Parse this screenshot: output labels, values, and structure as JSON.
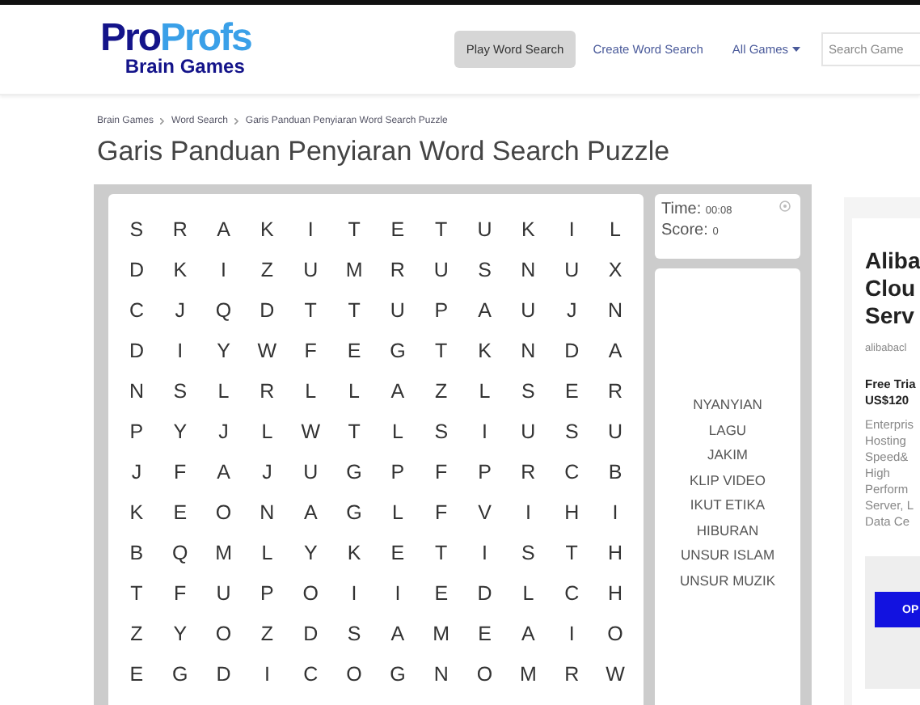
{
  "header": {
    "logo": {
      "top": "Pro",
      "top_accent": "Profs",
      "bottom": "Brain Games"
    },
    "nav": [
      {
        "label": "Play Word Search",
        "selected": true
      },
      {
        "label": "Create Word Search",
        "selected": false
      },
      {
        "label": "All Games",
        "selected": false,
        "dropdown": true
      }
    ],
    "search": {
      "placeholder": "Search Game"
    }
  },
  "breadcrumb": [
    "Brain Games",
    "Word Search",
    "Garis Panduan Penyiaran Word Search Puzzle"
  ],
  "title": "Garis Panduan Penyiaran Word Search Puzzle",
  "grid": [
    [
      "S",
      "R",
      "A",
      "K",
      "I",
      "T",
      "E",
      "T",
      "U",
      "K",
      "I",
      "L"
    ],
    [
      "D",
      "K",
      "I",
      "Z",
      "U",
      "M",
      "R",
      "U",
      "S",
      "N",
      "U",
      "X"
    ],
    [
      "C",
      "J",
      "Q",
      "D",
      "T",
      "T",
      "U",
      "P",
      "A",
      "U",
      "J",
      "N"
    ],
    [
      "D",
      "I",
      "Y",
      "W",
      "F",
      "E",
      "G",
      "T",
      "K",
      "N",
      "D",
      "A"
    ],
    [
      "N",
      "S",
      "L",
      "R",
      "L",
      "L",
      "A",
      "Z",
      "L",
      "S",
      "E",
      "R"
    ],
    [
      "P",
      "Y",
      "J",
      "L",
      "W",
      "T",
      "L",
      "S",
      "I",
      "U",
      "S",
      "U"
    ],
    [
      "J",
      "F",
      "A",
      "J",
      "U",
      "G",
      "P",
      "F",
      "P",
      "R",
      "C",
      "B"
    ],
    [
      "K",
      "E",
      "O",
      "N",
      "A",
      "G",
      "L",
      "F",
      "V",
      "I",
      "H",
      "I"
    ],
    [
      "B",
      "Q",
      "M",
      "L",
      "Y",
      "K",
      "E",
      "T",
      "I",
      "S",
      "T",
      "H"
    ],
    [
      "T",
      "F",
      "U",
      "P",
      "O",
      "I",
      "I",
      "E",
      "D",
      "L",
      "C",
      "H"
    ],
    [
      "Z",
      "Y",
      "O",
      "Z",
      "D",
      "S",
      "A",
      "M",
      "E",
      "A",
      "I",
      "O"
    ],
    [
      "E",
      "G",
      "D",
      "I",
      "C",
      "O",
      "G",
      "N",
      "O",
      "M",
      "R",
      "W"
    ]
  ],
  "status": {
    "time_label": "Time:",
    "time": "00:08",
    "score_label": "Score:",
    "score": "0"
  },
  "words": [
    "NYANYIAN",
    "LAGU",
    "JAKIM",
    "KLIP VIDEO",
    "IKUT ETIKA",
    "HIBURAN",
    "UNSUR ISLAM",
    "UNSUR MUZIK"
  ],
  "ad": {
    "title": [
      "Aliba",
      "Clou",
      "Serv"
    ],
    "source": "alibabacl",
    "offer": [
      "Free Tria",
      "US$120"
    ],
    "body": [
      "Enterpris",
      "Hosting",
      "Speed&",
      "High",
      "Perform",
      "Server, L",
      "Data Ce"
    ],
    "button": "OP"
  }
}
